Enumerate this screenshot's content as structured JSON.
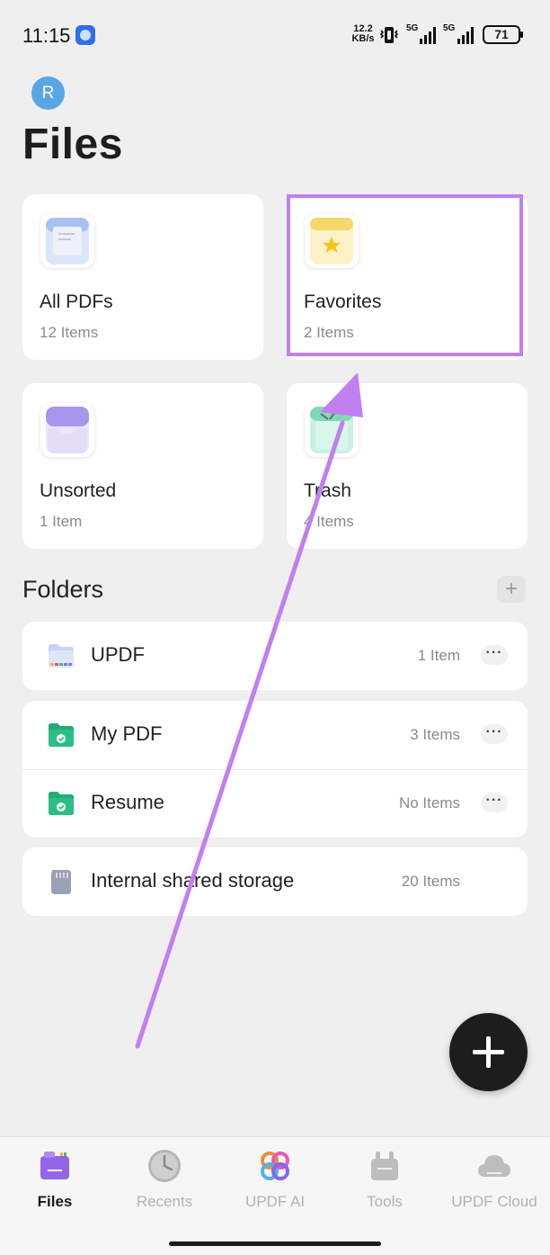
{
  "status_bar": {
    "time": "11:15",
    "net_speed_value": "12.2",
    "net_speed_unit": "KB/s",
    "signal1_label": "5G",
    "signal2_label": "5G",
    "battery": "71"
  },
  "header": {
    "avatar_initial": "R",
    "title": "Files"
  },
  "cards": [
    {
      "name": "All PDFs",
      "count": "12 Items",
      "icon": "documents-icon"
    },
    {
      "name": "Favorites",
      "count": "2 Items",
      "icon": "favorites-star-icon"
    },
    {
      "name": "Unsorted",
      "count": "1 Item",
      "icon": "inbox-tray-icon"
    },
    {
      "name": "Trash",
      "count": "4 Items",
      "icon": "trash-bin-icon"
    }
  ],
  "folders": {
    "title": "Folders",
    "add_label": "+",
    "items": [
      {
        "name": "UPDF",
        "count": "1 Item"
      },
      {
        "name": "My PDF",
        "count": "3 Items"
      },
      {
        "name": "Resume",
        "count": "No Items"
      },
      {
        "name": "Internal shared storage",
        "count": "20 Items"
      }
    ],
    "more_label": "···"
  },
  "bottom_nav": [
    {
      "label": "Files",
      "active": true,
      "icon": "files-icon"
    },
    {
      "label": "Recents",
      "active": false,
      "icon": "clock-icon"
    },
    {
      "label": "UPDF AI",
      "active": false,
      "icon": "ai-flower-icon"
    },
    {
      "label": "Tools",
      "active": false,
      "icon": "toolbox-icon"
    },
    {
      "label": "UPDF Cloud",
      "active": false,
      "icon": "cloud-icon"
    }
  ],
  "colors": {
    "accent": "#7b61e8",
    "annotation": "#c17ff0",
    "folder_green": "#2bbf87",
    "background": "#efefef"
  }
}
